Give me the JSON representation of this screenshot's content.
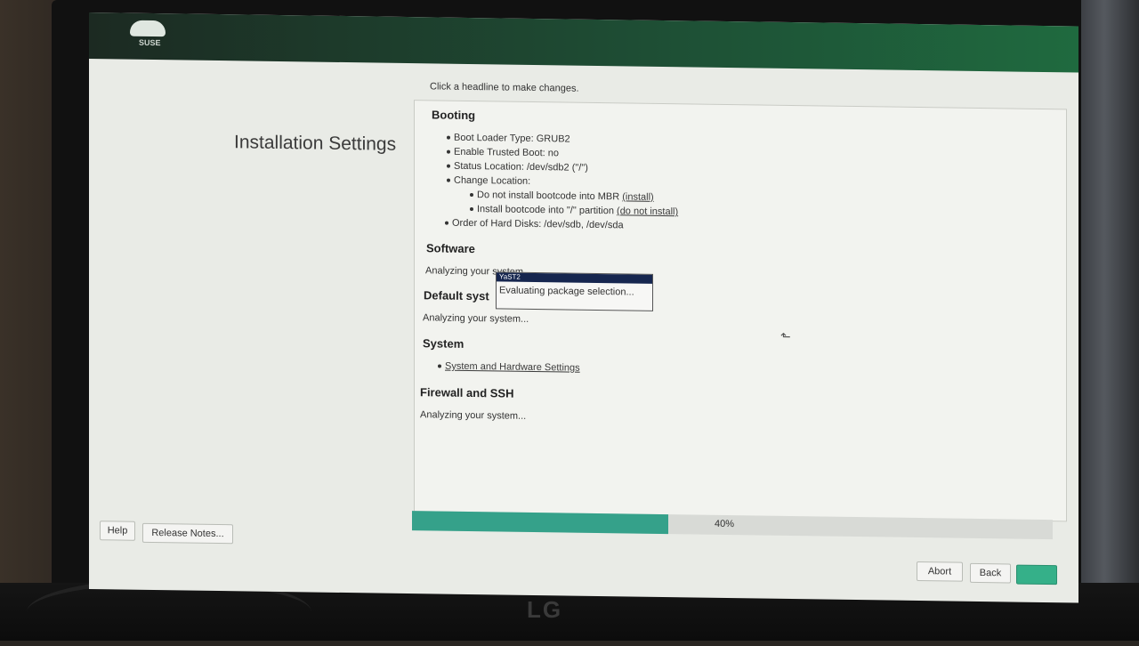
{
  "monitor": {
    "brand_logo": "LG"
  },
  "header": {
    "brand_label": "SUSE"
  },
  "page_title": "Installation Settings",
  "hint": "Click a headline to make changes.",
  "booting": {
    "title": "Booting",
    "items": [
      "Boot Loader Type: GRUB2",
      "Enable Trusted Boot: no",
      "Status Location: /dev/sdb2 (\"/\")",
      "Change Location:"
    ],
    "sub_items": [
      {
        "text": "Do not install bootcode into MBR",
        "link": "(install)"
      },
      {
        "text": "Install bootcode into \"/\" partition",
        "link": "(do not install)"
      }
    ],
    "disk_order": "Order of Hard Disks: /dev/sdb, /dev/sda"
  },
  "software": {
    "title": "Software",
    "status": "Analyzing your system..."
  },
  "default_systemd": {
    "title": "Default syst",
    "status": "Analyzing your system..."
  },
  "system": {
    "title": "System",
    "link": "System and Hardware Settings"
  },
  "firewall": {
    "title": "Firewall and SSH",
    "status": "Analyzing your system..."
  },
  "popup": {
    "header": "YaST2",
    "text": "Evaluating package selection..."
  },
  "progress": {
    "value": 0.4,
    "label": "40%"
  },
  "footer": {
    "help": "Help",
    "release_notes": "Release Notes...",
    "abort": "Abort",
    "back": "Back",
    "next": ""
  },
  "colors": {
    "accent": "#35a18a",
    "topbar": "#1f6a3f",
    "popup_header": "#16264f"
  }
}
